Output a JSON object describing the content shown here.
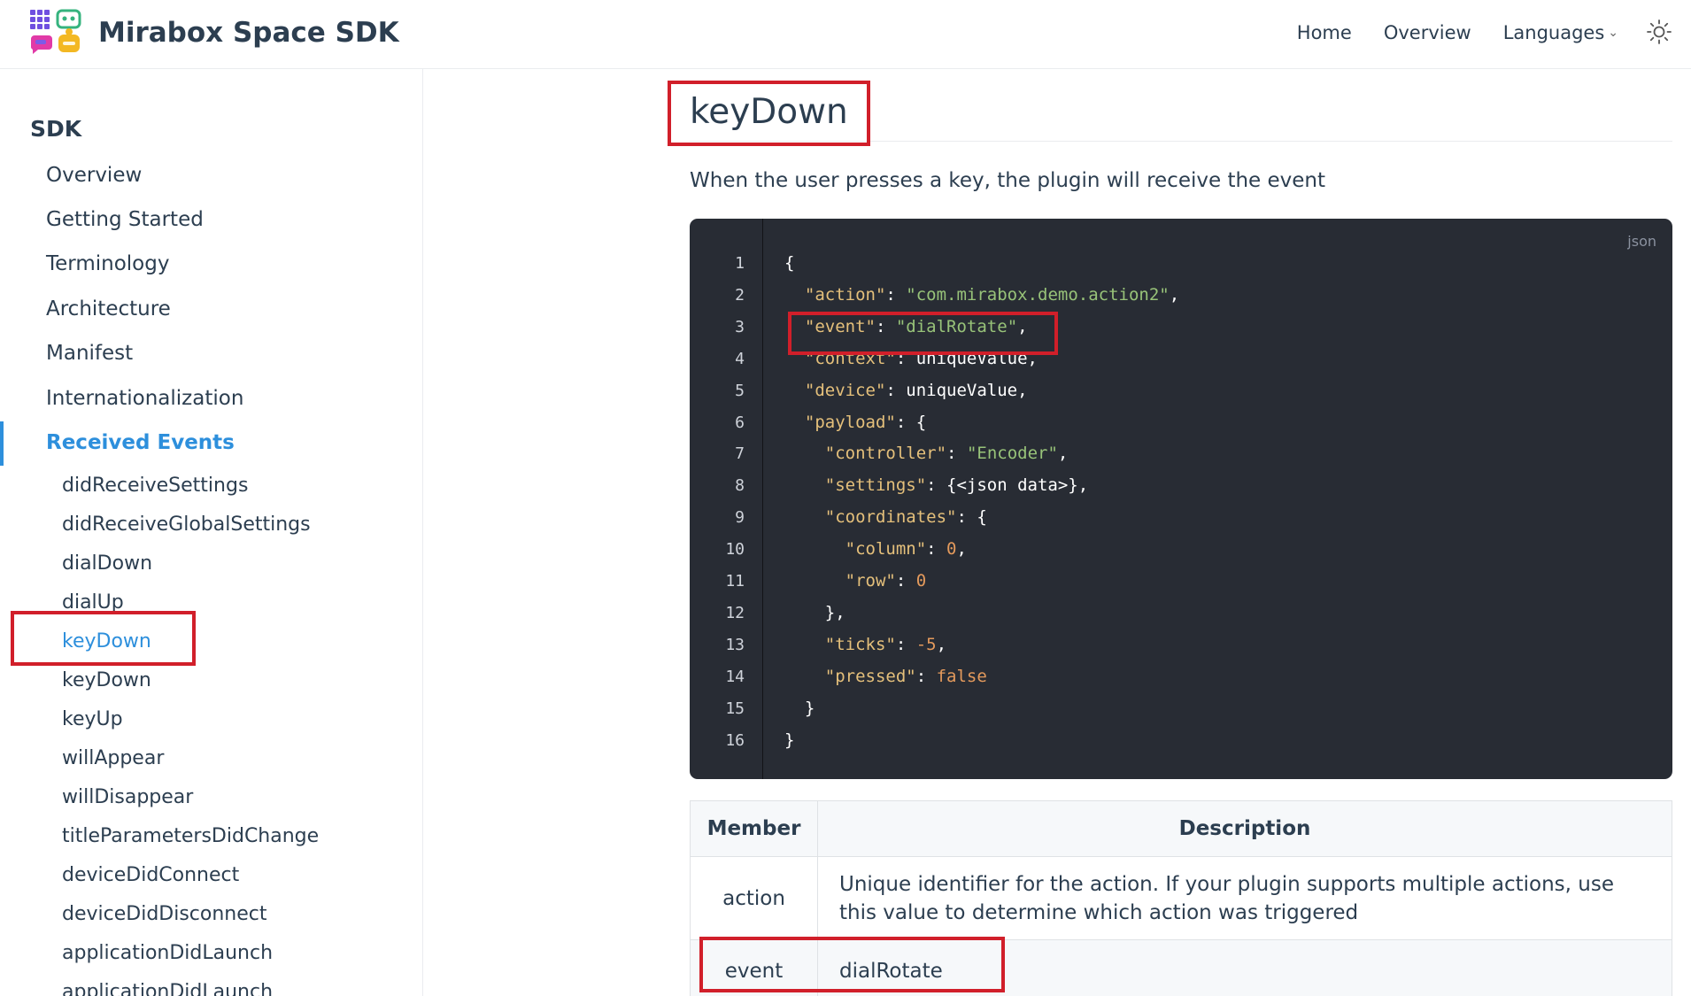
{
  "header": {
    "site_title": "Mirabox Space SDK",
    "nav": [
      "Home",
      "Overview",
      "Languages"
    ],
    "languages_chevron": "chevron-down-icon",
    "theme_icon": "sun-icon"
  },
  "sidebar": {
    "heading": "SDK",
    "items": [
      {
        "label": "Overview"
      },
      {
        "label": "Getting Started"
      },
      {
        "label": "Terminology"
      },
      {
        "label": "Architecture"
      },
      {
        "label": "Manifest"
      },
      {
        "label": "Internationalization"
      },
      {
        "label": "Received Events",
        "active": true
      }
    ],
    "sub_items": [
      {
        "label": "didReceiveSettings"
      },
      {
        "label": "didReceiveGlobalSettings"
      },
      {
        "label": "dialDown"
      },
      {
        "label": "dialUp"
      },
      {
        "label": "keyDown",
        "active": true
      },
      {
        "label": "keyDown"
      },
      {
        "label": "keyUp"
      },
      {
        "label": "willAppear"
      },
      {
        "label": "willDisappear"
      },
      {
        "label": "titleParametersDidChange"
      },
      {
        "label": "deviceDidConnect"
      },
      {
        "label": "deviceDidDisconnect"
      },
      {
        "label": "applicationDidLaunch"
      },
      {
        "label": "applicationDidLaunch"
      }
    ]
  },
  "content": {
    "title": "keyDown",
    "intro": "When the user presses a key, the plugin will receive the event",
    "code": {
      "language": "json",
      "line_numbers": [
        "1",
        "2",
        "3",
        "4",
        "5",
        "6",
        "7",
        "8",
        "9",
        "10",
        "11",
        "12",
        "13",
        "14",
        "15",
        "16"
      ],
      "lines": [
        [
          {
            "t": "p",
            "v": "{"
          }
        ],
        [
          {
            "t": "p",
            "v": "  "
          },
          {
            "t": "k",
            "v": "\"action\""
          },
          {
            "t": "p",
            "v": ": "
          },
          {
            "t": "s",
            "v": "\"com.mirabox.demo.action2\""
          },
          {
            "t": "p",
            "v": ","
          }
        ],
        [
          {
            "t": "p",
            "v": "  "
          },
          {
            "t": "k",
            "v": "\"event\""
          },
          {
            "t": "p",
            "v": ": "
          },
          {
            "t": "s",
            "v": "\"dialRotate\""
          },
          {
            "t": "p",
            "v": ","
          }
        ],
        [
          {
            "t": "p",
            "v": "  "
          },
          {
            "t": "k",
            "v": "\"context\""
          },
          {
            "t": "p",
            "v": ": uniqueValue,"
          }
        ],
        [
          {
            "t": "p",
            "v": "  "
          },
          {
            "t": "k",
            "v": "\"device\""
          },
          {
            "t": "p",
            "v": ": uniqueValue,"
          }
        ],
        [
          {
            "t": "p",
            "v": "  "
          },
          {
            "t": "k",
            "v": "\"payload\""
          },
          {
            "t": "p",
            "v": ": {"
          }
        ],
        [
          {
            "t": "p",
            "v": "    "
          },
          {
            "t": "k",
            "v": "\"controller\""
          },
          {
            "t": "p",
            "v": ": "
          },
          {
            "t": "s",
            "v": "\"Encoder\""
          },
          {
            "t": "p",
            "v": ","
          }
        ],
        [
          {
            "t": "p",
            "v": "    "
          },
          {
            "t": "k",
            "v": "\"settings\""
          },
          {
            "t": "p",
            "v": ": {<json data>},"
          }
        ],
        [
          {
            "t": "p",
            "v": "    "
          },
          {
            "t": "k",
            "v": "\"coordinates\""
          },
          {
            "t": "p",
            "v": ": {"
          }
        ],
        [
          {
            "t": "p",
            "v": "      "
          },
          {
            "t": "k",
            "v": "\"column\""
          },
          {
            "t": "p",
            "v": ": "
          },
          {
            "t": "n",
            "v": "0"
          },
          {
            "t": "p",
            "v": ","
          }
        ],
        [
          {
            "t": "p",
            "v": "      "
          },
          {
            "t": "k",
            "v": "\"row\""
          },
          {
            "t": "p",
            "v": ": "
          },
          {
            "t": "n",
            "v": "0"
          }
        ],
        [
          {
            "t": "p",
            "v": "    },"
          }
        ],
        [
          {
            "t": "p",
            "v": "    "
          },
          {
            "t": "k",
            "v": "\"ticks\""
          },
          {
            "t": "p",
            "v": ": "
          },
          {
            "t": "n",
            "v": "-5"
          },
          {
            "t": "p",
            "v": ","
          }
        ],
        [
          {
            "t": "p",
            "v": "    "
          },
          {
            "t": "k",
            "v": "\"pressed\""
          },
          {
            "t": "p",
            "v": ": "
          },
          {
            "t": "n",
            "v": "false"
          }
        ],
        [
          {
            "t": "p",
            "v": "  }"
          }
        ],
        [
          {
            "t": "p",
            "v": "}"
          }
        ]
      ]
    },
    "table": {
      "headers": [
        "Member",
        "Description"
      ],
      "rows": [
        {
          "member": "action",
          "description": "Unique identifier for the action. If your plugin supports multiple actions, use this value to determine which action was triggered"
        },
        {
          "member": "event",
          "description": "dialRotate"
        }
      ]
    }
  },
  "colors": {
    "accent": "#2d8fdc",
    "highlight": "#d11f2a",
    "code_bg": "#282c34",
    "code_key": "#e5c07b",
    "code_string": "#98c379",
    "code_number": "#e49a5c"
  }
}
